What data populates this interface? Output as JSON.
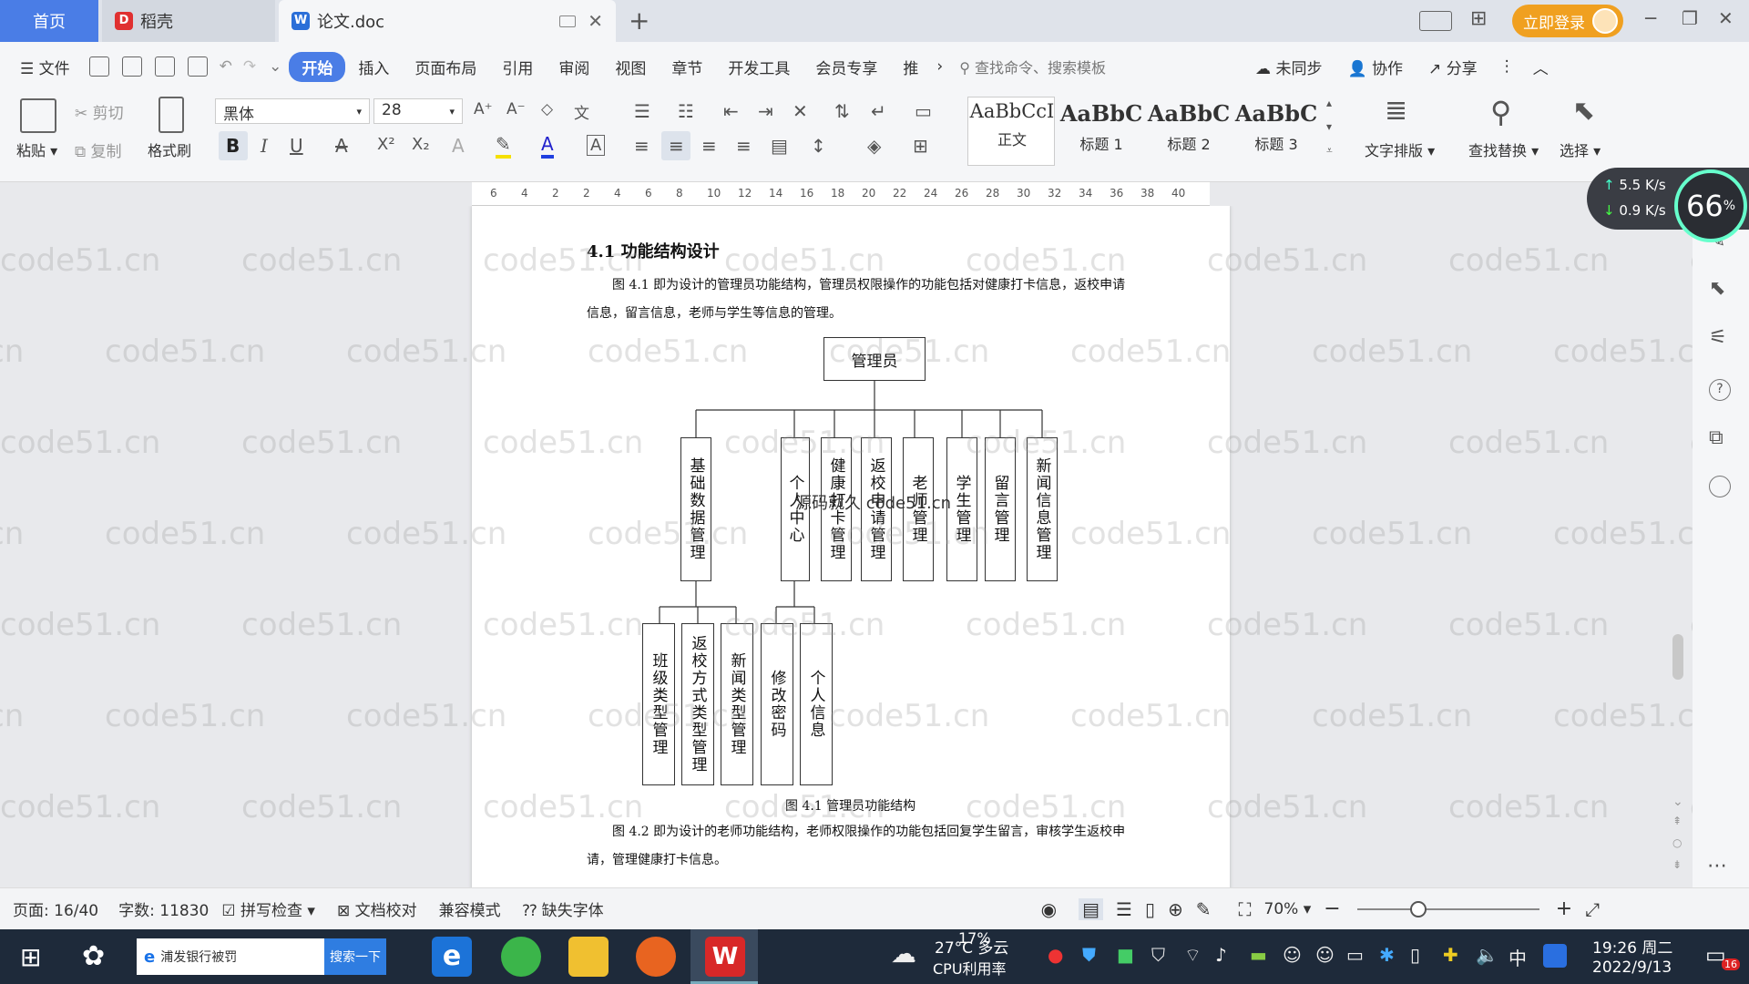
{
  "tabs": {
    "home": "首页",
    "daoke": "稻壳",
    "doc": "论文.doc",
    "new_tab": "+"
  },
  "title_bar": {
    "login": "立即登录"
  },
  "menu": {
    "file": "文件",
    "items": [
      "开始",
      "插入",
      "页面布局",
      "引用",
      "审阅",
      "视图",
      "章节",
      "开发工具",
      "会员专享",
      "推"
    ],
    "search_cmd": "查找命令、搜索模板",
    "sync": "未同步",
    "collab": "协作",
    "share": "分享"
  },
  "ribbon": {
    "paste": "粘贴",
    "cut": "剪切",
    "copy": "复制",
    "format_painter": "格式刷",
    "font": "黑体",
    "size": "28",
    "styles": [
      {
        "preview": "AaBbCcI",
        "name": "正文"
      },
      {
        "preview": "AaBbC",
        "name": "标题 1"
      },
      {
        "preview": "AaBbC",
        "name": "标题 2"
      },
      {
        "preview": "AaBbC",
        "name": "标题 3"
      }
    ],
    "text_layout": "文字排版",
    "find_replace": "查找替换",
    "select": "选择"
  },
  "ruler_ticks": [
    "6",
    "4",
    "2",
    "2",
    "4",
    "6",
    "8",
    "10",
    "12",
    "14",
    "16",
    "18",
    "20",
    "22",
    "24",
    "26",
    "28",
    "30",
    "32",
    "34",
    "36",
    "38",
    "40"
  ],
  "net": {
    "up": "5.5",
    "down": "0.9",
    "unit": "K/s",
    "percent": "66",
    "percent_unit": "%"
  },
  "document": {
    "section_title": "4.1  功能结构设计",
    "para1": "图 4.1 即为设计的管理员功能结构，管理员权限操作的功能包括对健康打卡信息，返校申请信息，留言信息，老师与学生等信息的管理。",
    "diagram": {
      "root": "管理员",
      "level1": [
        "基础数据管理",
        "个人中心",
        "健康打卡管理",
        "返校申请管理",
        "老师管理",
        "学生管理",
        "留言管理",
        "新闻信息管理"
      ],
      "level2": [
        "班级类型管理",
        "返校方式类型管理",
        "新闻类型管理",
        "修改密码",
        "个人信息"
      ]
    },
    "overlay": "源码就久 code51.cn",
    "caption": "图 4.1  管理员功能结构",
    "para2": "图 4.2 即为设计的老师功能结构，老师权限操作的功能包括回复学生留言，审核学生返校申请，管理健康打卡信息。",
    "watermark": "code51.cn"
  },
  "status": {
    "page": "页面: 16/40",
    "words": "字数: 11830",
    "spell": "拼写检查",
    "proof": "文档校对",
    "compat": "兼容模式",
    "missing_font": "缺失字体",
    "zoom": "70%"
  },
  "taskbar": {
    "search_text": "浦发银行被罚",
    "search_btn": "搜索一下",
    "weather_temp": "27°C",
    "weather_desc": "多云",
    "cpu": "17%",
    "cpu_label": "CPU利用率",
    "ime": "中",
    "time": "19:26 周二",
    "date": "2022/9/13",
    "notify": "16"
  }
}
